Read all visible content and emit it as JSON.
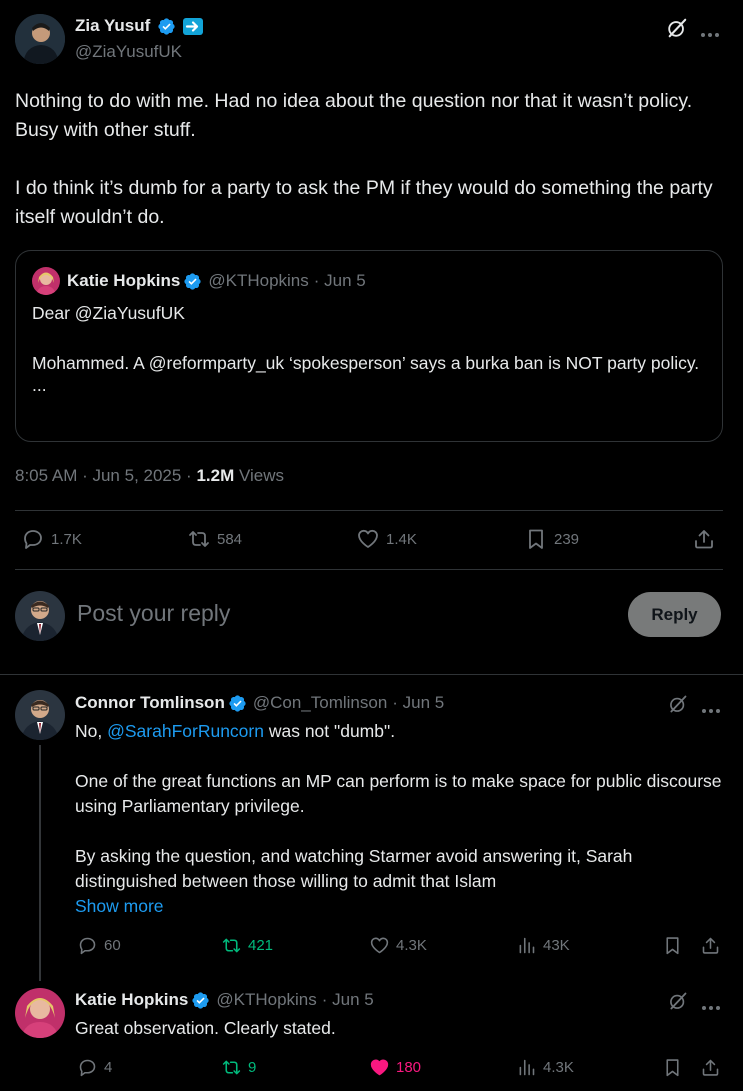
{
  "main_tweet": {
    "author_name": "Zia Yusuf",
    "author_handle": "@ZiaYusufUK",
    "text_p1": "Nothing to do with me. Had no idea about the question nor that it wasn’t policy. Busy with other stuff.",
    "text_p2": "I do think it’s dumb for a party to ask the PM if they would do something the party itself wouldn’t do.",
    "timestamp": "8:05 AM · Jun 5, 2025 · ",
    "views_count": "1.2M",
    "views_label": " Views",
    "stats": {
      "replies": "1.7K",
      "reposts": "584",
      "likes": "1.4K",
      "bookmarks": "239"
    }
  },
  "quote": {
    "author_name": "Katie Hopkins",
    "author_handle": "@KTHopkins",
    "date": "· Jun 5",
    "line1": "Dear @ZiaYusufUK",
    "line2": "Mohammed. A @reformparty_uk ‘spokesperson’ says a burka ban is NOT party policy.",
    "line3": "..."
  },
  "composer": {
    "placeholder": "Post your reply",
    "reply_button": "Reply"
  },
  "replies": [
    {
      "author_name": "Connor Tomlinson",
      "author_handle": "@Con_Tomlinson",
      "date": "· Jun 5",
      "text_prefix": "No, ",
      "mention": "@SarahForRuncorn",
      "text_suffix": " was not \"dumb\".",
      "p2": "One of the great functions an MP can perform is to make space for public discourse using Parliamentary privilege.",
      "p3": "By asking the question, and watching Starmer avoid answering it, Sarah distinguished between those willing to admit that Islam",
      "show_more": "Show more",
      "stats": {
        "replies": "60",
        "reposts": "421",
        "likes": "4.3K",
        "views": "43K"
      }
    },
    {
      "author_name": "Katie Hopkins",
      "author_handle": "@KTHopkins",
      "date": "· Jun 5",
      "text": "Great observation. Clearly stated.",
      "stats": {
        "replies": "4",
        "reposts": "9",
        "likes": "180",
        "views": "4.3K"
      }
    }
  ],
  "colors": {
    "accent": "#1d9bf0",
    "repost_active": "#00ba7c",
    "like_active": "#f91880",
    "muted": "#71767b",
    "divider": "#2f3336"
  }
}
